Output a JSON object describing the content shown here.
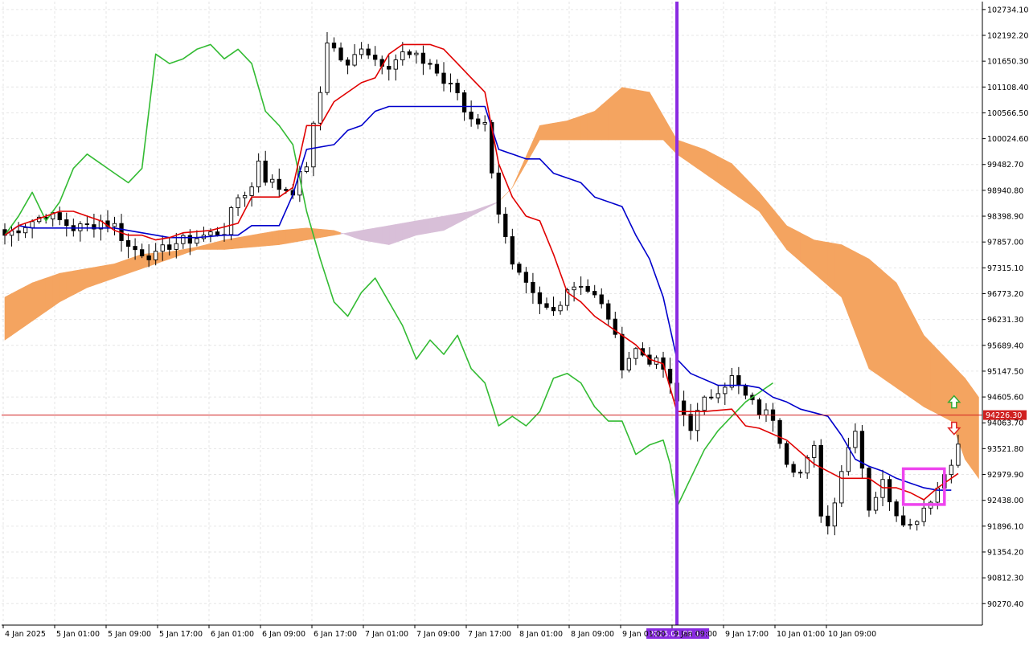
{
  "chart_data": {
    "type": "candlestick",
    "indicator": "Ichimoku Kinko Hyo",
    "y_axis_ticks": [
      "102734.10",
      "102192.20",
      "101650.30",
      "101108.40",
      "100566.50",
      "100024.60",
      "99482.70",
      "98940.80",
      "98398.90",
      "97857.00",
      "97315.10",
      "96773.20",
      "96231.30",
      "95689.40",
      "95147.50",
      "94605.60",
      "94063.70",
      "93521.80",
      "92979.90",
      "92438.00",
      "91896.10",
      "91354.20",
      "90812.30",
      "90270.40"
    ],
    "y_axis_range": [
      89820,
      102900
    ],
    "x_axis_ticks": [
      "4 Jan 2025",
      "5 Jan 01:00",
      "5 Jan 09:00",
      "5 Jan 17:00",
      "6 Jan 01:00",
      "6 Jan 09:00",
      "6 Jan 17:00",
      "7 Jan 01:00",
      "7 Jan 09:00",
      "7 Jan 17:00",
      "8 Jan 01:00",
      "8 Jan 09:00",
      "9 Jan 01:00",
      "9 Jan 09:00",
      "9 Jan 17:00",
      "10 Jan 01:00",
      "10 Jan 09:00"
    ],
    "current_price": "94226.30",
    "current_price_value": 94226.3,
    "cursor_time_label": "2025.01.08 19:00",
    "cursor_bar_index": 98,
    "bars_count": 140,
    "bullish_arrow_bar": 137,
    "bearish_arrow_bar": 137,
    "highlight_box": {
      "bar_start": 131,
      "bar_end": 137,
      "price_top": 93100,
      "price_bottom": 92350
    },
    "grid": true,
    "colors": {
      "background": "#ffffff",
      "grid": "#e6e6e6",
      "tenkan": "#e00000",
      "kijun": "#0000cc",
      "chikou": "#33bb33",
      "cloud_bull": "#f4a460",
      "cloud_bear": "#d8bfd8",
      "candle_bull_body": "#ffffff",
      "candle_bear_body": "#000000",
      "candle_outline": "#000000",
      "cursor_line": "#8a2be2",
      "price_line": "#d02020",
      "price_label_bg": "#d02020",
      "highlight_box": "#ee44ee",
      "arrow_up": "#33aa33",
      "arrow_down": "#dd2222"
    },
    "price_path": [
      [
        0,
        98000
      ],
      [
        6,
        98450
      ],
      [
        8,
        98300
      ],
      [
        10,
        98150
      ],
      [
        12,
        98180
      ],
      [
        14,
        98300
      ],
      [
        16,
        98200
      ],
      [
        18,
        97750
      ],
      [
        22,
        97550
      ],
      [
        24,
        97800
      ],
      [
        28,
        97950
      ],
      [
        32,
        98100
      ],
      [
        34,
        98800
      ],
      [
        36,
        99000
      ],
      [
        37,
        99600
      ],
      [
        38,
        99200
      ],
      [
        40,
        99000
      ],
      [
        42,
        98950
      ],
      [
        44,
        99500
      ],
      [
        46,
        101000
      ],
      [
        47,
        102100
      ],
      [
        50,
        101500
      ],
      [
        52,
        102000
      ],
      [
        54,
        101700
      ],
      [
        56,
        101600
      ],
      [
        58,
        101800
      ],
      [
        60,
        101700
      ],
      [
        62,
        101600
      ],
      [
        64,
        101200
      ],
      [
        66,
        101000
      ],
      [
        67,
        100600
      ],
      [
        68,
        100500
      ],
      [
        70,
        100300
      ],
      [
        72,
        98500
      ],
      [
        74,
        97300
      ],
      [
        76,
        96900
      ],
      [
        78,
        96500
      ],
      [
        80,
        96400
      ],
      [
        82,
        96900
      ],
      [
        84,
        97000
      ],
      [
        86,
        96700
      ],
      [
        88,
        96300
      ],
      [
        90,
        95300
      ],
      [
        92,
        95600
      ],
      [
        94,
        95400
      ],
      [
        96,
        95200
      ],
      [
        97,
        94800
      ],
      [
        98,
        94500
      ],
      [
        100,
        94000
      ],
      [
        102,
        94500
      ],
      [
        104,
        94800
      ],
      [
        106,
        95000
      ],
      [
        108,
        94600
      ],
      [
        110,
        94300
      ],
      [
        112,
        94200
      ],
      [
        114,
        93300
      ],
      [
        116,
        93000
      ],
      [
        118,
        93500
      ],
      [
        119,
        92200
      ],
      [
        120,
        91900
      ],
      [
        122,
        93100
      ],
      [
        124,
        94000
      ],
      [
        126,
        92300
      ],
      [
        128,
        92800
      ],
      [
        130,
        92200
      ],
      [
        132,
        91900
      ],
      [
        134,
        92300
      ],
      [
        136,
        92700
      ],
      [
        138,
        93300
      ],
      [
        140,
        93800
      ],
      [
        142,
        94100
      ],
      [
        143,
        94226
      ]
    ],
    "tenkan_path": [
      [
        0,
        98000
      ],
      [
        2,
        98200
      ],
      [
        4,
        98300
      ],
      [
        6,
        98400
      ],
      [
        8,
        98500
      ],
      [
        10,
        98500
      ],
      [
        12,
        98400
      ],
      [
        14,
        98300
      ],
      [
        16,
        98100
      ],
      [
        18,
        98000
      ],
      [
        20,
        98000
      ],
      [
        22,
        97900
      ],
      [
        24,
        97950
      ],
      [
        26,
        98050
      ],
      [
        30,
        98100
      ],
      [
        34,
        98250
      ],
      [
        36,
        98800
      ],
      [
        40,
        98800
      ],
      [
        42,
        99000
      ],
      [
        44,
        100300
      ],
      [
        46,
        100300
      ],
      [
        48,
        100800
      ],
      [
        52,
        101200
      ],
      [
        54,
        101300
      ],
      [
        56,
        101800
      ],
      [
        58,
        102000
      ],
      [
        62,
        102000
      ],
      [
        64,
        101900
      ],
      [
        66,
        101600
      ],
      [
        68,
        101300
      ],
      [
        70,
        101000
      ],
      [
        72,
        99500
      ],
      [
        74,
        98800
      ],
      [
        76,
        98400
      ],
      [
        78,
        98300
      ],
      [
        80,
        97600
      ],
      [
        82,
        96800
      ],
      [
        84,
        96600
      ],
      [
        86,
        96300
      ],
      [
        88,
        96100
      ],
      [
        90,
        95900
      ],
      [
        92,
        95700
      ],
      [
        94,
        95400
      ],
      [
        96,
        95300
      ],
      [
        98,
        94300
      ],
      [
        102,
        94300
      ],
      [
        106,
        94350
      ],
      [
        108,
        94000
      ],
      [
        110,
        93950
      ],
      [
        114,
        93700
      ],
      [
        118,
        93200
      ],
      [
        122,
        92900
      ],
      [
        126,
        92900
      ],
      [
        128,
        92700
      ],
      [
        130,
        92700
      ],
      [
        132,
        92600
      ],
      [
        134,
        92450
      ],
      [
        136,
        92700
      ],
      [
        138,
        92900
      ],
      [
        139,
        93000
      ]
    ],
    "kijun_path": [
      [
        0,
        98000
      ],
      [
        2,
        98200
      ],
      [
        4,
        98150
      ],
      [
        8,
        98150
      ],
      [
        10,
        98150
      ],
      [
        14,
        98150
      ],
      [
        16,
        98150
      ],
      [
        18,
        98100
      ],
      [
        22,
        98000
      ],
      [
        24,
        97950
      ],
      [
        28,
        97950
      ],
      [
        32,
        98000
      ],
      [
        34,
        98000
      ],
      [
        36,
        98200
      ],
      [
        40,
        98200
      ],
      [
        42,
        98850
      ],
      [
        44,
        99800
      ],
      [
        48,
        99900
      ],
      [
        50,
        100200
      ],
      [
        52,
        100300
      ],
      [
        54,
        100600
      ],
      [
        56,
        100700
      ],
      [
        60,
        100700
      ],
      [
        64,
        100700
      ],
      [
        66,
        100700
      ],
      [
        70,
        100700
      ],
      [
        72,
        99800
      ],
      [
        74,
        99700
      ],
      [
        76,
        99600
      ],
      [
        78,
        99600
      ],
      [
        80,
        99300
      ],
      [
        84,
        99100
      ],
      [
        86,
        98800
      ],
      [
        90,
        98600
      ],
      [
        92,
        98000
      ],
      [
        94,
        97500
      ],
      [
        96,
        96700
      ],
      [
        98,
        95400
      ],
      [
        100,
        95100
      ],
      [
        104,
        94850
      ],
      [
        108,
        94850
      ],
      [
        110,
        94800
      ],
      [
        112,
        94600
      ],
      [
        114,
        94500
      ],
      [
        116,
        94350
      ],
      [
        120,
        94200
      ],
      [
        122,
        93800
      ],
      [
        124,
        93300
      ],
      [
        126,
        93150
      ],
      [
        128,
        93050
      ],
      [
        130,
        92900
      ],
      [
        132,
        92800
      ],
      [
        134,
        92700
      ],
      [
        136,
        92650
      ],
      [
        138,
        92650
      ]
    ],
    "chikou_path": [
      [
        0,
        98000
      ],
      [
        2,
        98400
      ],
      [
        4,
        98900
      ],
      [
        6,
        98300
      ],
      [
        8,
        98700
      ],
      [
        10,
        99400
      ],
      [
        12,
        99700
      ],
      [
        14,
        99500
      ],
      [
        16,
        99300
      ],
      [
        18,
        99100
      ],
      [
        20,
        99400
      ],
      [
        22,
        101800
      ],
      [
        24,
        101600
      ],
      [
        26,
        101700
      ],
      [
        28,
        101900
      ],
      [
        30,
        102000
      ],
      [
        32,
        101700
      ],
      [
        34,
        101900
      ],
      [
        36,
        101600
      ],
      [
        38,
        100600
      ],
      [
        40,
        100300
      ],
      [
        42,
        99900
      ],
      [
        44,
        98500
      ],
      [
        46,
        97500
      ],
      [
        48,
        96600
      ],
      [
        50,
        96300
      ],
      [
        52,
        96800
      ],
      [
        54,
        97100
      ],
      [
        56,
        96600
      ],
      [
        58,
        96100
      ],
      [
        60,
        95400
      ],
      [
        62,
        95800
      ],
      [
        64,
        95500
      ],
      [
        66,
        95900
      ],
      [
        68,
        95200
      ],
      [
        70,
        94900
      ],
      [
        72,
        94000
      ],
      [
        74,
        94200
      ],
      [
        76,
        94000
      ],
      [
        78,
        94300
      ],
      [
        80,
        95000
      ],
      [
        82,
        95100
      ],
      [
        84,
        94900
      ],
      [
        86,
        94400
      ],
      [
        88,
        94100
      ],
      [
        90,
        94100
      ],
      [
        92,
        93400
      ],
      [
        94,
        93600
      ],
      [
        96,
        93700
      ],
      [
        97,
        93200
      ],
      [
        98,
        92300
      ],
      [
        100,
        92900
      ],
      [
        102,
        93500
      ],
      [
        104,
        93900
      ],
      [
        106,
        94200
      ],
      [
        108,
        94500
      ],
      [
        110,
        94700
      ],
      [
        112,
        94900
      ]
    ],
    "senkou_a_path": [
      [
        0,
        96700
      ],
      [
        4,
        97000
      ],
      [
        8,
        97200
      ],
      [
        12,
        97300
      ],
      [
        16,
        97400
      ],
      [
        20,
        97600
      ],
      [
        24,
        97650
      ],
      [
        28,
        97750
      ],
      [
        32,
        97900
      ],
      [
        36,
        98000
      ],
      [
        40,
        98100
      ],
      [
        44,
        98150
      ],
      [
        48,
        98100
      ],
      [
        52,
        97900
      ],
      [
        56,
        97800
      ],
      [
        60,
        98000
      ],
      [
        64,
        98100
      ],
      [
        68,
        98400
      ],
      [
        72,
        98700
      ],
      [
        74,
        99000
      ],
      [
        78,
        100300
      ],
      [
        82,
        100400
      ],
      [
        86,
        100600
      ],
      [
        90,
        101100
      ],
      [
        94,
        101000
      ],
      [
        96,
        100500
      ],
      [
        98,
        100000
      ],
      [
        102,
        99800
      ],
      [
        106,
        99500
      ],
      [
        110,
        98900
      ],
      [
        114,
        98200
      ],
      [
        118,
        97900
      ],
      [
        122,
        97800
      ],
      [
        126,
        97500
      ],
      [
        130,
        97000
      ],
      [
        134,
        95900
      ],
      [
        138,
        95300
      ],
      [
        140,
        95000
      ],
      [
        142,
        94600
      ]
    ],
    "senkou_b_path": [
      [
        0,
        95800
      ],
      [
        4,
        96200
      ],
      [
        8,
        96600
      ],
      [
        12,
        96900
      ],
      [
        16,
        97100
      ],
      [
        20,
        97300
      ],
      [
        24,
        97500
      ],
      [
        28,
        97700
      ],
      [
        32,
        97700
      ],
      [
        36,
        97750
      ],
      [
        40,
        97800
      ],
      [
        44,
        97900
      ],
      [
        48,
        98000
      ],
      [
        52,
        98100
      ],
      [
        56,
        98200
      ],
      [
        60,
        98300
      ],
      [
        64,
        98400
      ],
      [
        68,
        98500
      ],
      [
        72,
        98700
      ],
      [
        74,
        99000
      ],
      [
        78,
        100000
      ],
      [
        82,
        100000
      ],
      [
        86,
        100000
      ],
      [
        90,
        100000
      ],
      [
        94,
        100000
      ],
      [
        96,
        100000
      ],
      [
        98,
        99700
      ],
      [
        102,
        99300
      ],
      [
        106,
        98900
      ],
      [
        110,
        98500
      ],
      [
        114,
        97700
      ],
      [
        118,
        97200
      ],
      [
        122,
        96700
      ],
      [
        126,
        95200
      ],
      [
        130,
        94800
      ],
      [
        134,
        94400
      ],
      [
        138,
        94100
      ],
      [
        140,
        93300
      ],
      [
        142,
        92900
      ]
    ]
  }
}
